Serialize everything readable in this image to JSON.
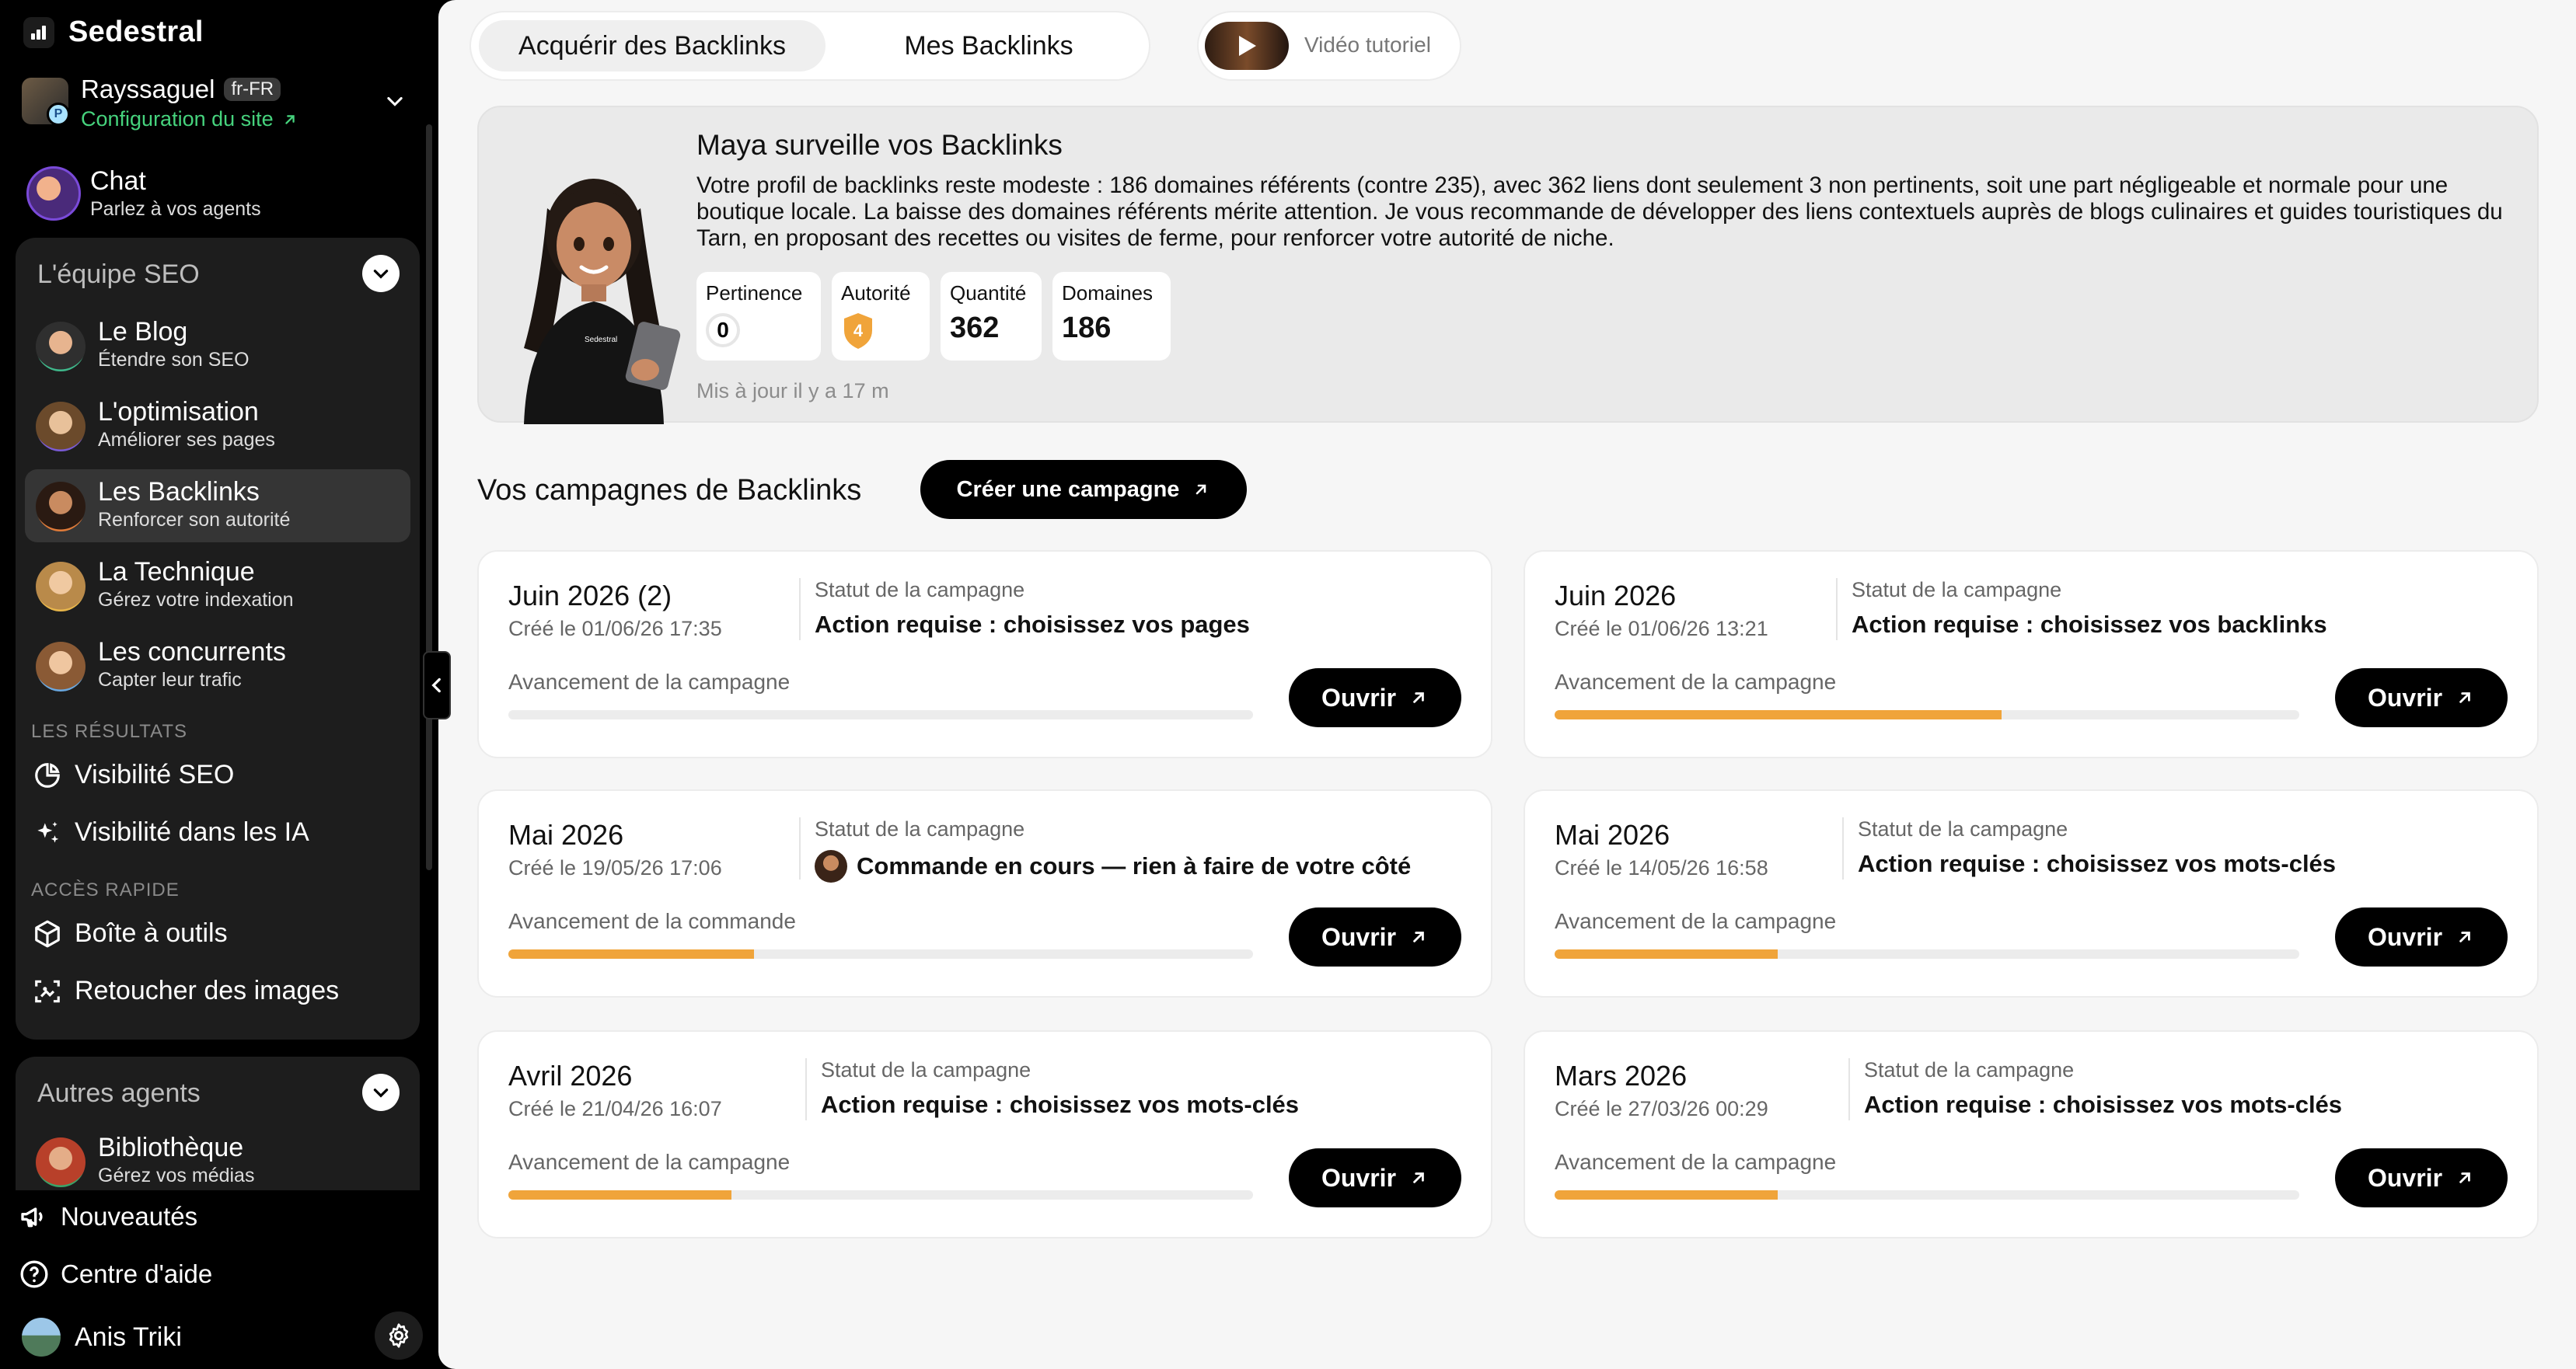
{
  "brand": {
    "name": "Sedestral"
  },
  "site": {
    "name": "Rayssaguel",
    "lang": "fr-FR",
    "config_link": "Configuration du site",
    "badge": "P"
  },
  "chat": {
    "title": "Chat",
    "subtitle": "Parlez à vos agents"
  },
  "seo_team": {
    "heading": "L'équipe SEO",
    "agents": [
      {
        "title": "Le Blog",
        "subtitle": "Étendre son SEO"
      },
      {
        "title": "L'optimisation",
        "subtitle": "Améliorer ses pages"
      },
      {
        "title": "Les Backlinks",
        "subtitle": "Renforcer son autorité"
      },
      {
        "title": "La Technique",
        "subtitle": "Gérez votre indexation"
      },
      {
        "title": "Les concurrents",
        "subtitle": "Capter leur trafic"
      }
    ]
  },
  "results": {
    "label": "LES RÉSULTATS",
    "items": [
      "Visibilité SEO",
      "Visibilité dans les IA"
    ]
  },
  "quick_access": {
    "label": "ACCÈS RAPIDE",
    "items": [
      "Boîte à outils",
      "Retoucher des images"
    ]
  },
  "other_agents": {
    "heading": "Autres agents",
    "agents": [
      {
        "title": "Bibliothèque",
        "subtitle": "Gérez vos médias"
      }
    ]
  },
  "footer": {
    "news": "Nouveautés",
    "help": "Centre d'aide",
    "user": "Anis Triki"
  },
  "tabs": {
    "acquire": "Acquérir des Backlinks",
    "mine": "Mes Backlinks",
    "video": "Vidéo tutoriel"
  },
  "hero": {
    "title": "Maya surveille vos Backlinks",
    "text": "Votre profil de backlinks reste modeste : 186 domaines référents (contre 235), avec 362 liens dont seulement 3 non pertinents, soit une part négligeable et normale pour une boutique locale. La baisse des domaines référents mérite attention. Je vous recommande de développer des liens contextuels auprès de blogs culinaires et guides touristiques du Tarn, en proposant des recettes ou visites de ferme, pour renforcer votre autorité de niche.",
    "metrics": [
      {
        "label": "Pertinence",
        "value": "0"
      },
      {
        "label": "Autorité",
        "value": "4"
      },
      {
        "label": "Quantité",
        "value": "362"
      },
      {
        "label": "Domaines",
        "value": "186"
      }
    ],
    "updated": "Mis à jour il y a 17 m"
  },
  "campaigns": {
    "title": "Vos campagnes de Backlinks",
    "create_label": "Créer une campagne",
    "status_label": "Statut de la campagne",
    "open_label": "Ouvrir",
    "accent": "#f0a43a",
    "items": [
      {
        "title": "Juin 2026 (2)",
        "date": "Créé le 01/06/26 17:35",
        "status": "Action requise : choisissez vos pages",
        "progress_label": "Avancement de la campagne",
        "progress": 0,
        "with_avatar": false
      },
      {
        "title": "Juin 2026",
        "date": "Créé le 01/06/26 13:21",
        "status": "Action requise : choisissez vos backlinks",
        "progress_label": "Avancement de la campagne",
        "progress": 0.6,
        "with_avatar": false
      },
      {
        "title": "Mai 2026",
        "date": "Créé le 19/05/26 17:06",
        "status": "Commande en cours — rien à faire de votre côté",
        "progress_label": "Avancement de la commande",
        "progress": 0.33,
        "with_avatar": true
      },
      {
        "title": "Mai 2026",
        "date": "Créé le 14/05/26 16:58",
        "status": "Action requise : choisissez vos mots-clés",
        "progress_label": "Avancement de la campagne",
        "progress": 0.3,
        "with_avatar": false
      },
      {
        "title": "Avril 2026",
        "date": "Créé le 21/04/26 16:07",
        "status": "Action requise : choisissez vos mots-clés",
        "progress_label": "Avancement de la campagne",
        "progress": 0.3,
        "with_avatar": false
      },
      {
        "title": "Mars 2026",
        "date": "Créé le 27/03/26 00:29",
        "status": "Action requise : choisissez vos mots-clés",
        "progress_label": "Avancement de la campagne",
        "progress": 0.3,
        "with_avatar": false
      }
    ]
  }
}
